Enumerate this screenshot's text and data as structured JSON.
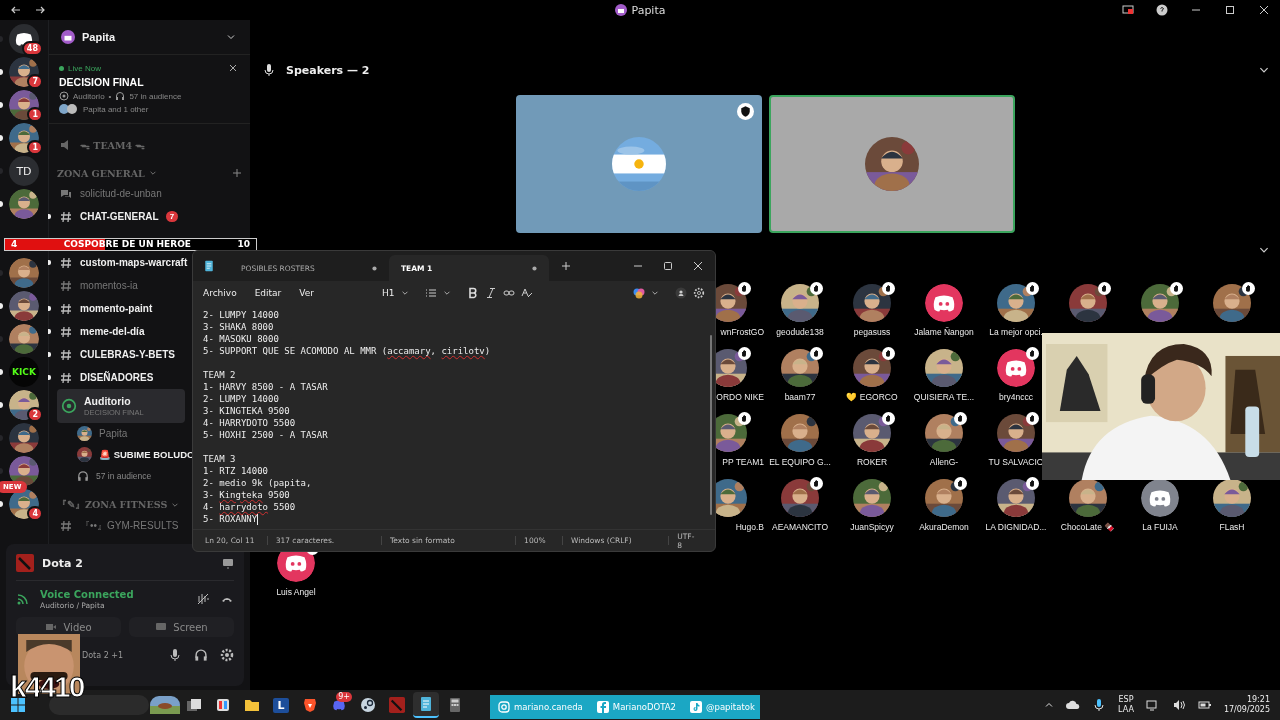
{
  "titlebar": {
    "title": "Papita"
  },
  "servers": [
    {
      "kind": "home",
      "badge": "48",
      "unread": false
    },
    {
      "kind": "picture",
      "badge": "7",
      "unread": true
    },
    {
      "kind": "picture",
      "badge": "1",
      "unread": true
    },
    {
      "kind": "picture",
      "badge": "1",
      "unread": true
    },
    {
      "kind": "text",
      "label": "TD",
      "unread": false
    },
    {
      "kind": "picture",
      "unread": true
    },
    {
      "kind": "picture",
      "unread": false
    },
    {
      "kind": "picture",
      "unread": true
    },
    {
      "kind": "picture",
      "unread": false
    },
    {
      "kind": "text",
      "label": "KICK",
      "unread": true
    },
    {
      "kind": "picture",
      "badge": "2",
      "unread": true
    },
    {
      "kind": "picture",
      "unread": false
    },
    {
      "kind": "picture",
      "unread": false
    },
    {
      "kind": "picture",
      "badge": "4",
      "tag": "NEW",
      "unread": true
    }
  ],
  "server_panel": {
    "name": "Papita"
  },
  "live_card": {
    "status": "Live Now",
    "title": "DECISION FINAL",
    "channel": "Auditorio",
    "separator": "•",
    "audience": "57 in audience",
    "participants": "Papita and 1 other"
  },
  "channels": [
    {
      "kind": "voice",
      "name": "ᯓ TEAM4 ᯓ"
    },
    {
      "kind": "category",
      "name": "ZONA GENERAL"
    },
    {
      "kind": "forum",
      "name": "solicitud-de-unban",
      "unread": false
    },
    {
      "kind": "text",
      "name": "CHAT-GENERAL",
      "unread": true,
      "badge": "7"
    },
    {
      "kind": "text",
      "name": "custom-maps-warcraft",
      "unread": true
    },
    {
      "kind": "text",
      "name": "momentos-ia",
      "unread": false
    },
    {
      "kind": "text",
      "name": "momento-paint",
      "unread": true
    },
    {
      "kind": "text",
      "name": "meme-del-día",
      "unread": true
    },
    {
      "kind": "text",
      "name": "CULEBRAS-Y-BETS",
      "unread": true
    },
    {
      "kind": "text",
      "name": "DISEÑADORES",
      "unread": true
    },
    {
      "kind": "stage",
      "name": "Auditorio",
      "subtitle": "DECISION FINAL",
      "selected": true
    },
    {
      "kind": "member",
      "name": "Papita",
      "active": false
    },
    {
      "kind": "member",
      "name": "🚨 SUBIME BOLUDO",
      "active": true
    },
    {
      "kind": "audience",
      "name": "57 in audience"
    },
    {
      "kind": "category",
      "name": "『✎』ZONA FITNESS"
    },
    {
      "kind": "text",
      "name": "『••』GYM-RESULTS",
      "unread": false
    }
  ],
  "voice_panel": {
    "activity": "Dota 2",
    "status": "Voice Connected",
    "location": "Auditorio / Papita",
    "video": "Video",
    "screen": "Screen",
    "user_status": "Dota 2 +1"
  },
  "goal": {
    "current": "4",
    "label": "COSPOBRE DE UN HEROE",
    "target": "10",
    "level": 0.4
  },
  "stream_tag": "k4410",
  "speakers": {
    "title": "Speakers — 2",
    "tiles": [
      {
        "speaking": false,
        "badge": true
      },
      {
        "speaking": true,
        "badge": false
      }
    ]
  },
  "audience": {
    "rows": [
      {
        "members": [
          {
            "name": "wnFrostGO",
            "kind": "picture",
            "badge": true
          },
          {
            "name": "geodude138",
            "kind": "picture",
            "badge": true
          },
          {
            "name": "pegasuss",
            "kind": "picture",
            "badge": true
          },
          {
            "name": "Jalame Ñangon",
            "kind": "default",
            "color": "#e3365f",
            "badge": false
          },
          {
            "name": "La mejor opci.",
            "kind": "picture",
            "badge": true
          },
          {
            "kind": "picture",
            "badge": true
          },
          {
            "kind": "picture",
            "badge": true
          },
          {
            "kind": "picture",
            "badge": true
          }
        ]
      },
      {
        "members": [
          {
            "name": "ORDO NIKE",
            "kind": "picture",
            "badge": true
          },
          {
            "name": "baam77",
            "kind": "picture",
            "badge": true
          },
          {
            "name": "💛 EGORCO",
            "kind": "picture",
            "badge": true
          },
          {
            "name": "QUISIERA TE...",
            "kind": "picture",
            "badge": false
          },
          {
            "name": "bry4nccc",
            "kind": "default",
            "color": "#e3365f",
            "badge": true
          }
        ]
      },
      {
        "members": [
          {
            "name": "PP TEAM1",
            "kind": "picture",
            "badge": true
          },
          {
            "name": "EL EQUIPO G...",
            "kind": "picture",
            "badge": false
          },
          {
            "name": "ROKER",
            "kind": "picture",
            "badge": true
          },
          {
            "name": "AllenG-",
            "kind": "picture",
            "badge": true
          },
          {
            "name": "TU SALVACIO",
            "kind": "picture",
            "badge": true
          }
        ]
      },
      {
        "members": [
          {
            "name": "Hugo.B",
            "kind": "picture",
            "badge": false
          },
          {
            "name": "AEAMANCITO",
            "kind": "picture",
            "badge": true
          },
          {
            "name": "JuanSpicyy",
            "kind": "picture",
            "badge": false
          },
          {
            "name": "AkuraDemon",
            "kind": "picture",
            "badge": true
          },
          {
            "name": "LA DIGNIDAD...",
            "kind": "picture",
            "badge": true
          },
          {
            "name": "ChocoLate 🍫",
            "kind": "picture",
            "badge": false
          },
          {
            "name": "La FUIJA",
            "kind": "default",
            "color": "#80848e",
            "badge": false
          },
          {
            "name": "FLasH",
            "kind": "picture",
            "badge": false
          }
        ]
      },
      {
        "members": [
          {
            "name": "Luis Angel",
            "kind": "default",
            "color": "#e3365f",
            "badge": true
          }
        ]
      }
    ]
  },
  "notepad": {
    "tabs": [
      {
        "label": "POSIBLES ROSTERS",
        "selected": false
      },
      {
        "label": "TEAM 1",
        "selected": true
      }
    ],
    "menu": [
      "Archivo",
      "Editar",
      "Ver"
    ],
    "heading": "H1",
    "blocks": [
      {
        "lines": [
          [
            {
              "text": "2- LUMPY 14000",
              "flagged": false
            }
          ],
          [
            {
              "text": "3- SHAKA 8000",
              "flagged": false
            }
          ],
          [
            {
              "text": "4- MASOKU 8000",
              "flagged": false
            }
          ],
          [
            {
              "text": "5- SUPPORT QUE SE ACOMODO AL MMR (",
              "flagged": false
            },
            {
              "text": "accamary",
              "flagged": true
            },
            {
              "text": ", ",
              "flagged": false
            },
            {
              "text": "cirilotv",
              "flagged": true
            },
            {
              "text": ")",
              "flagged": false
            }
          ]
        ]
      },
      {
        "lines": [
          [
            {
              "text": "TEAM 2",
              "flagged": false
            }
          ],
          [
            {
              "text": "1- HARVY 8500 - A TASAR",
              "flagged": false
            }
          ],
          [
            {
              "text": "2- LUMPY 14000",
              "flagged": false
            }
          ],
          [
            {
              "text": "3- KINGTEKA 9500",
              "flagged": false
            }
          ],
          [
            {
              "text": "4- HARRYDOTO 5500",
              "flagged": false
            }
          ],
          [
            {
              "text": "5- HOXHI 2500 - A TASAR",
              "flagged": false
            }
          ]
        ]
      },
      {
        "lines": [
          [
            {
              "text": "TEAM 3",
              "flagged": false
            }
          ],
          [
            {
              "text": "1- RTZ 14000",
              "flagged": false
            }
          ],
          [
            {
              "text": "2- medio 9k (papita,",
              "flagged": false
            }
          ],
          [
            {
              "text": "3- ",
              "flagged": false
            },
            {
              "text": "Kingteka",
              "flagged": true
            },
            {
              "text": " 9500",
              "flagged": false
            }
          ],
          [
            {
              "text": "4- ",
              "flagged": false
            },
            {
              "text": "harrydoto",
              "flagged": true
            },
            {
              "text": " 5500",
              "flagged": false
            }
          ],
          [
            {
              "text": "5- ROXANNY",
              "flagged": false
            }
          ]
        ]
      }
    ],
    "caret_at_end": true,
    "status": [
      "Ln 20, Col 11",
      "317 caracteres.",
      "Texto sin formato",
      "100%",
      "Windows (CRLF)",
      "UTF-8"
    ]
  },
  "socials": [
    {
      "kind": "instagram",
      "handle": "mariano.caneda"
    },
    {
      "kind": "facebook",
      "handle": "MarianoDOTA2"
    },
    {
      "kind": "tiktok",
      "handle": "@papitatok"
    }
  ],
  "taskbar": {
    "apps": [
      {
        "kind": "widget",
        "active": false
      },
      {
        "kind": "taskview",
        "active": false
      },
      {
        "kind": "paint",
        "active": false
      },
      {
        "kind": "folder",
        "active": false
      },
      {
        "kind": "letter",
        "label": "L",
        "active": false
      },
      {
        "kind": "brave",
        "active": false
      },
      {
        "kind": "discord",
        "badge": "9+",
        "active": false
      },
      {
        "kind": "steam",
        "active": false
      },
      {
        "kind": "dota",
        "active": false
      },
      {
        "kind": "notepad",
        "active": true
      },
      {
        "kind": "calculator",
        "active": false
      }
    ],
    "lang": "ESP",
    "layout": "LAA",
    "time": "19:21",
    "date": "17/09/2025"
  }
}
